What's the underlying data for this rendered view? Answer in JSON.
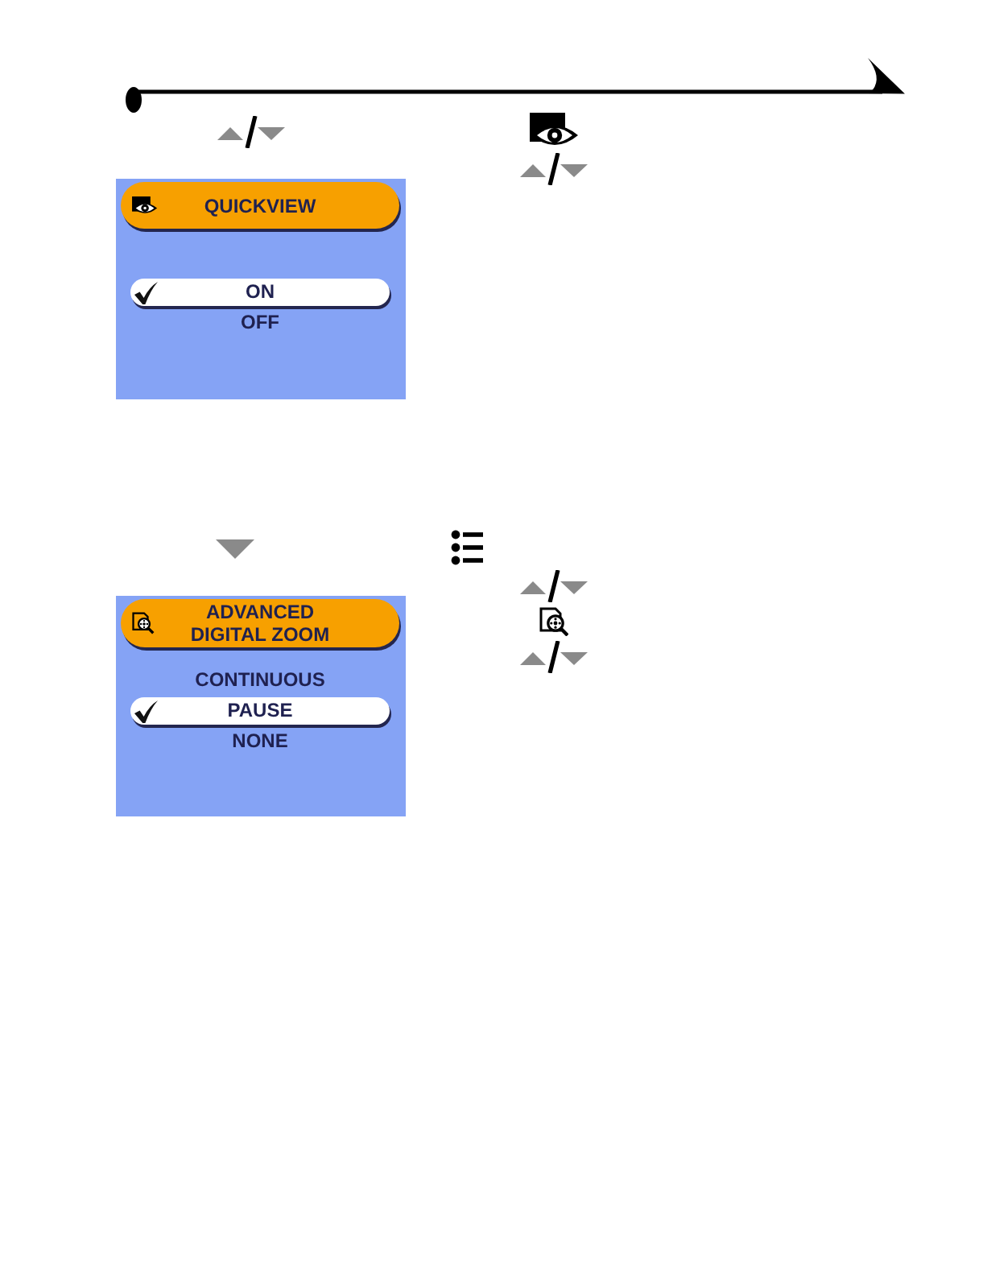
{
  "sections": [
    {
      "lead_icons": [
        {
          "kind": "updown"
        }
      ],
      "step_icons": [
        {
          "kind": "eye"
        },
        {
          "kind": "updown"
        }
      ],
      "screen": {
        "title_icon": {
          "kind": "eye"
        },
        "title": "QUICKVIEW",
        "options": [
          {
            "label": "ON",
            "selected": true
          },
          {
            "label": "OFF",
            "selected": false
          }
        ]
      }
    },
    {
      "lead_icons": [
        {
          "kind": "down"
        }
      ],
      "step_icons": [
        {
          "kind": "menu"
        },
        {
          "kind": "updown"
        },
        {
          "kind": "zoom"
        },
        {
          "kind": "updown"
        }
      ],
      "screen": {
        "title_icon": {
          "kind": "zoom"
        },
        "title": "ADVANCED\nDIGITAL ZOOM",
        "options": [
          {
            "label": "CONTINUOUS",
            "selected": false
          },
          {
            "label": "PAUSE",
            "selected": true
          },
          {
            "label": "NONE",
            "selected": false
          }
        ]
      }
    }
  ]
}
